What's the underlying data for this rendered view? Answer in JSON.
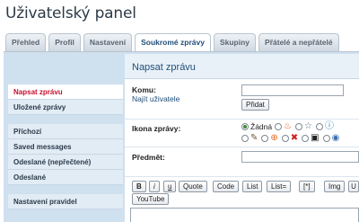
{
  "page_title": "Uživatelský panel",
  "tabs": [
    {
      "label": "Přehled",
      "active": false
    },
    {
      "label": "Profil",
      "active": false
    },
    {
      "label": "Nastavení",
      "active": false
    },
    {
      "label": "Soukromé zprávy",
      "active": true
    },
    {
      "label": "Skupiny",
      "active": false
    },
    {
      "label": "Přátelé a nepřátelé",
      "active": false
    }
  ],
  "sidebar": {
    "group1": [
      {
        "label": "Napsat zprávu",
        "active": true
      },
      {
        "label": "Uložené zprávy",
        "active": false
      }
    ],
    "group2": [
      {
        "label": "Příchozí",
        "active": false
      },
      {
        "label": "Saved messages",
        "active": false
      },
      {
        "label": "Odeslané (nepřečtené)",
        "active": false
      },
      {
        "label": "Odeslané",
        "active": false
      }
    ],
    "group3": [
      {
        "label": "Nastavení pravidel",
        "active": false
      }
    ]
  },
  "main": {
    "heading": "Napsat zprávu",
    "to_label": "Komu:",
    "find_user_link": "Najít uživatele",
    "add_button": "Přidat",
    "icon_label": "Ikona zprávy:",
    "icon_none_label": "Žádná",
    "subject_label": "Předmět:"
  },
  "toolbar": {
    "buttons": [
      "B",
      "i",
      "u",
      "Quote",
      "Code",
      "List",
      "List=",
      "[*]",
      "Img",
      "U"
    ],
    "youtube": "YouTube"
  },
  "colors": {
    "accent": "#1f4e79",
    "active_sidebar_text": "#c8102e",
    "frame_bg": "#cfe0ef"
  }
}
